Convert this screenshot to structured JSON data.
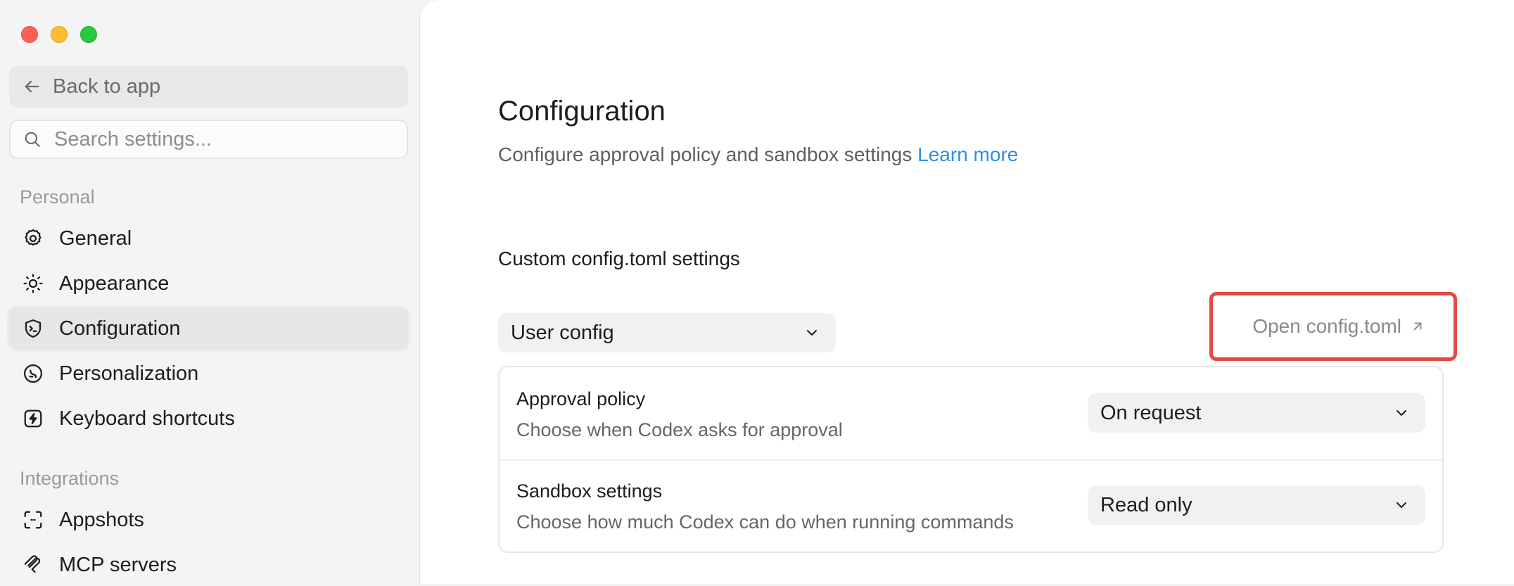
{
  "sidebar": {
    "back_label": "Back to app",
    "search_placeholder": "Search settings...",
    "section_personal": "Personal",
    "section_integrations": "Integrations",
    "items": [
      {
        "label": "General",
        "icon": "gear-icon"
      },
      {
        "label": "Appearance",
        "icon": "sun-icon"
      },
      {
        "label": "Configuration",
        "icon": "shield-terminal-icon",
        "active": true
      },
      {
        "label": "Personalization",
        "icon": "personalization-icon"
      },
      {
        "label": "Keyboard shortcuts",
        "icon": "lightning-icon"
      },
      {
        "label": "Appshots",
        "icon": "screenshot-frame-icon"
      },
      {
        "label": "MCP servers",
        "icon": "mcp-icon"
      }
    ]
  },
  "main": {
    "title": "Configuration",
    "subtitle": "Configure approval policy and sandbox settings",
    "learn_more": "Learn more",
    "section_title": "Custom config.toml settings",
    "config_select_value": "User config",
    "open_config_label": "Open config.toml",
    "rows": [
      {
        "title": "Approval policy",
        "desc": "Choose when Codex asks for approval",
        "value": "On request"
      },
      {
        "title": "Sandbox settings",
        "desc": "Choose how much Codex can do when running commands",
        "value": "Read only"
      }
    ]
  },
  "colors": {
    "accent_link": "#2f8fe8",
    "highlight_box": "#e34a45"
  }
}
